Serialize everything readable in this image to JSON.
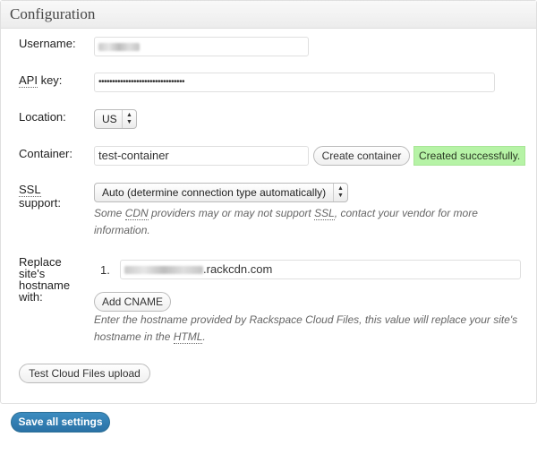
{
  "panel": {
    "title": "Configuration"
  },
  "username": {
    "label": "Username:"
  },
  "api_key": {
    "label_prefix": "API",
    "label_suffix": " key:",
    "value": "••••••••••••••••••••••••••••••••"
  },
  "location": {
    "label": "Location:",
    "selected": "US"
  },
  "container": {
    "label": "Container:",
    "value": "test-container",
    "create_button": "Create container",
    "status": "Created successfully."
  },
  "ssl": {
    "label_abbr": "SSL",
    "label_rest": "support:",
    "selected": "Auto (determine connection type automatically)",
    "desc_1": "Some ",
    "desc_cdn": "CDN",
    "desc_2": " providers may or may not support ",
    "desc_ssl": "SSL",
    "desc_3": ", contact your vendor for more information."
  },
  "cname": {
    "label_line1": "Replace",
    "label_line2": "site's",
    "label_line3": "hostname",
    "label_line4": "with:",
    "item_number": "1.",
    "domain_suffix": ".rackcdn.com",
    "add_button": "Add CNAME",
    "desc_1": "Enter the hostname provided by Rackspace Cloud Files, this value will replace your site's hostname in the ",
    "desc_html": "HTML",
    "desc_2": "."
  },
  "test_button": "Test Cloud Files upload",
  "save_button": "Save all settings"
}
